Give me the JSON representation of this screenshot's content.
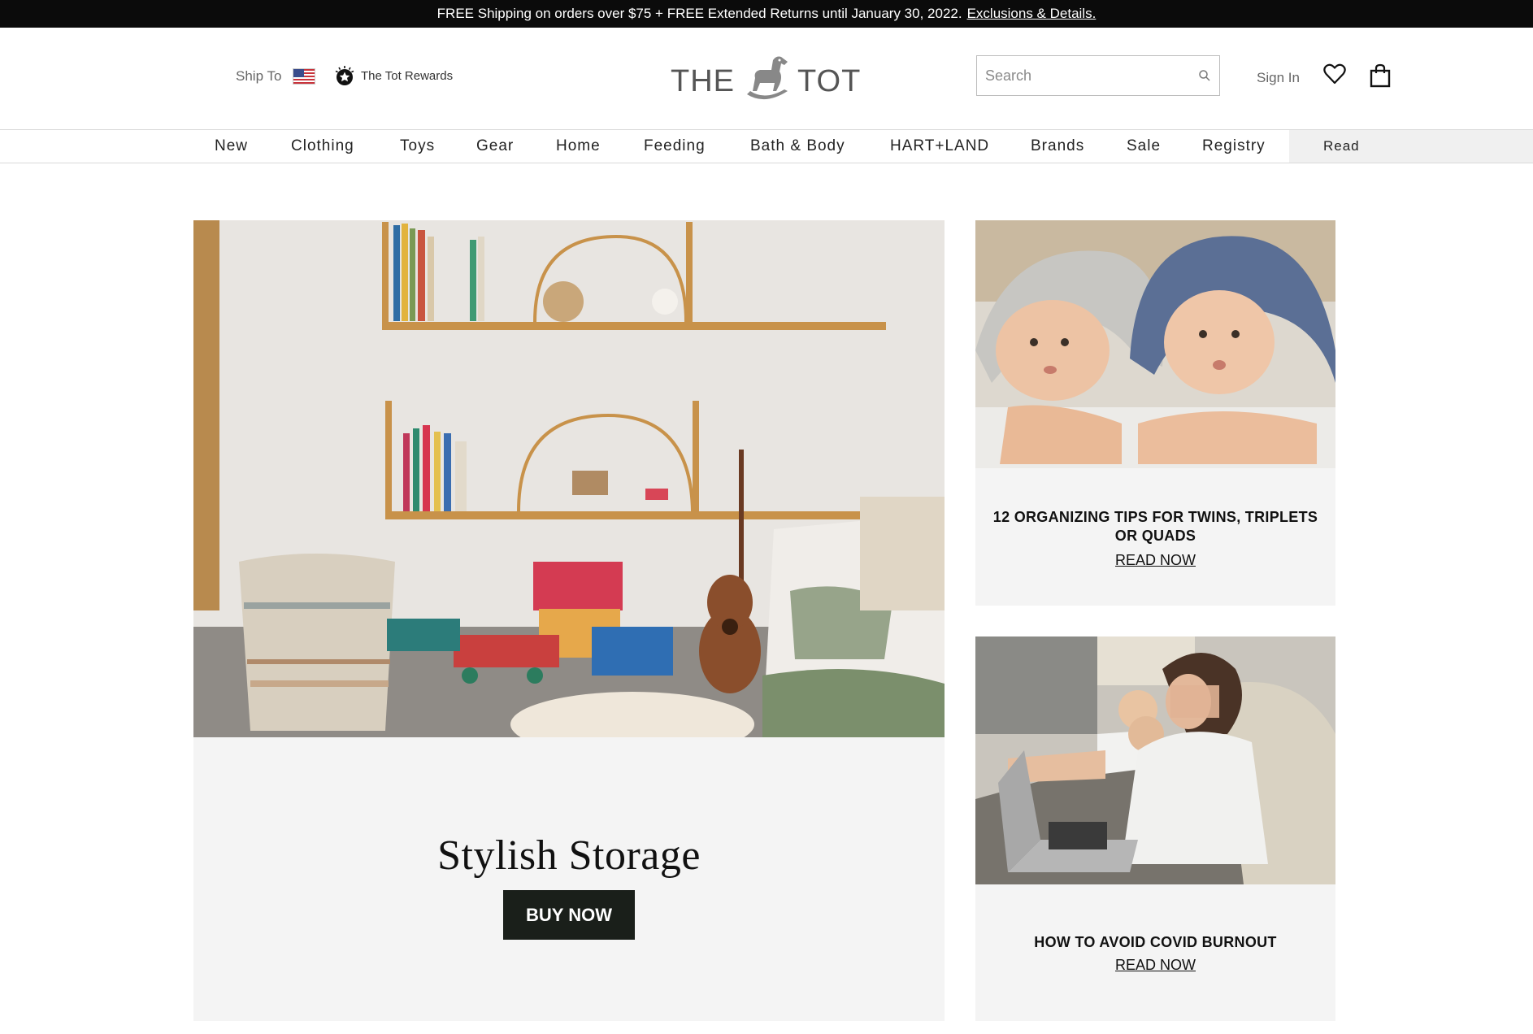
{
  "promo": {
    "text": "FREE Shipping on orders over $75 + FREE Extended Returns until January 30, 2022.",
    "link": "Exclusions & Details."
  },
  "header": {
    "ship_to": "Ship To",
    "flag_icon": "us-flag-icon",
    "rewards_label": "The Tot Rewards",
    "logo_text_left": "THE",
    "logo_text_right": "TOT",
    "search_placeholder": "Search",
    "sign_in": "Sign In",
    "icons": [
      "search-icon",
      "heart-icon",
      "shopping-bag-icon",
      "rewards-star-icon",
      "rocking-horse-icon"
    ]
  },
  "nav": {
    "items": [
      "New",
      "Clothing",
      "Toys",
      "Gear",
      "Home",
      "Feeding",
      "Bath & Body",
      "HART+LAND",
      "Brands",
      "Sale",
      "Registry"
    ],
    "read": "Read"
  },
  "hero": {
    "title": "Stylish Storage",
    "button": "BUY NOW"
  },
  "cards": [
    {
      "title": "12 ORGANIZING TIPS FOR TWINS, TRIPLETS OR QUADS",
      "link": "READ NOW"
    },
    {
      "title": "HOW TO AVOID COVID BURNOUT",
      "link": "READ NOW"
    }
  ],
  "colors": {
    "promo_bg": "#0b0b0b",
    "card_bg": "#f4f4f4",
    "button_bg": "#1a1f1a",
    "nav_read_bg": "#f0f0f0"
  }
}
